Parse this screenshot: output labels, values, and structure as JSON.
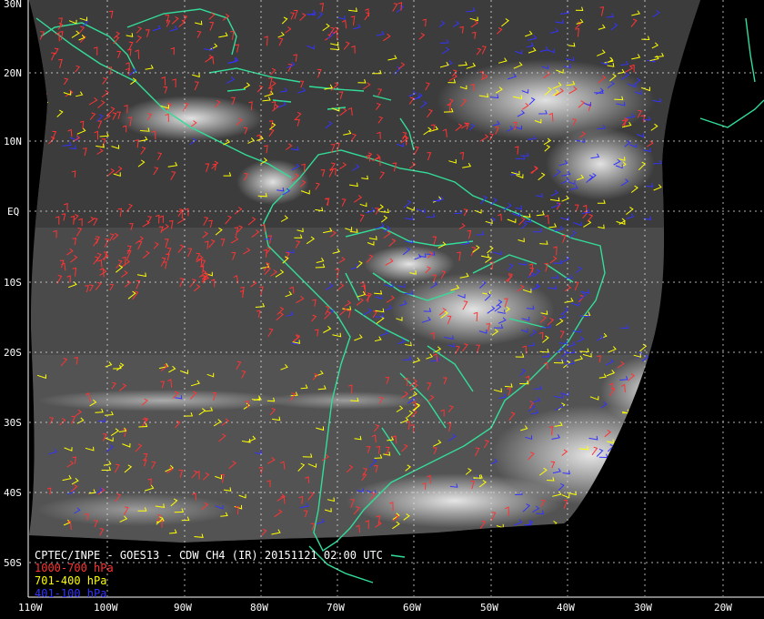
{
  "title": "CPTEC/INPE - GOES13 - CDW CH4 (IR) 20151121 02:00 UTC",
  "legend": [
    {
      "label": "1000-700 hPa",
      "color": "#ff3333"
    },
    {
      "label": "701-400 hPa",
      "color": "#ffff00"
    },
    {
      "label": "401-100 hPa",
      "color": "#3333ff"
    }
  ],
  "lat_labels": [
    "30N",
    "20N",
    "10N",
    "EQ",
    "10S",
    "20S",
    "30S",
    "40S",
    "50S"
  ],
  "lon_labels": [
    "110W",
    "100W",
    "90W",
    "80W",
    "70W",
    "60W",
    "50W",
    "40W",
    "30W",
    "20W"
  ],
  "colors": {
    "background": "#000000",
    "coastline": "#33dd99",
    "grid": "#dddddd",
    "low_level": "#ff3333",
    "mid_level": "#ffff00",
    "high_level": "#3333ff"
  }
}
